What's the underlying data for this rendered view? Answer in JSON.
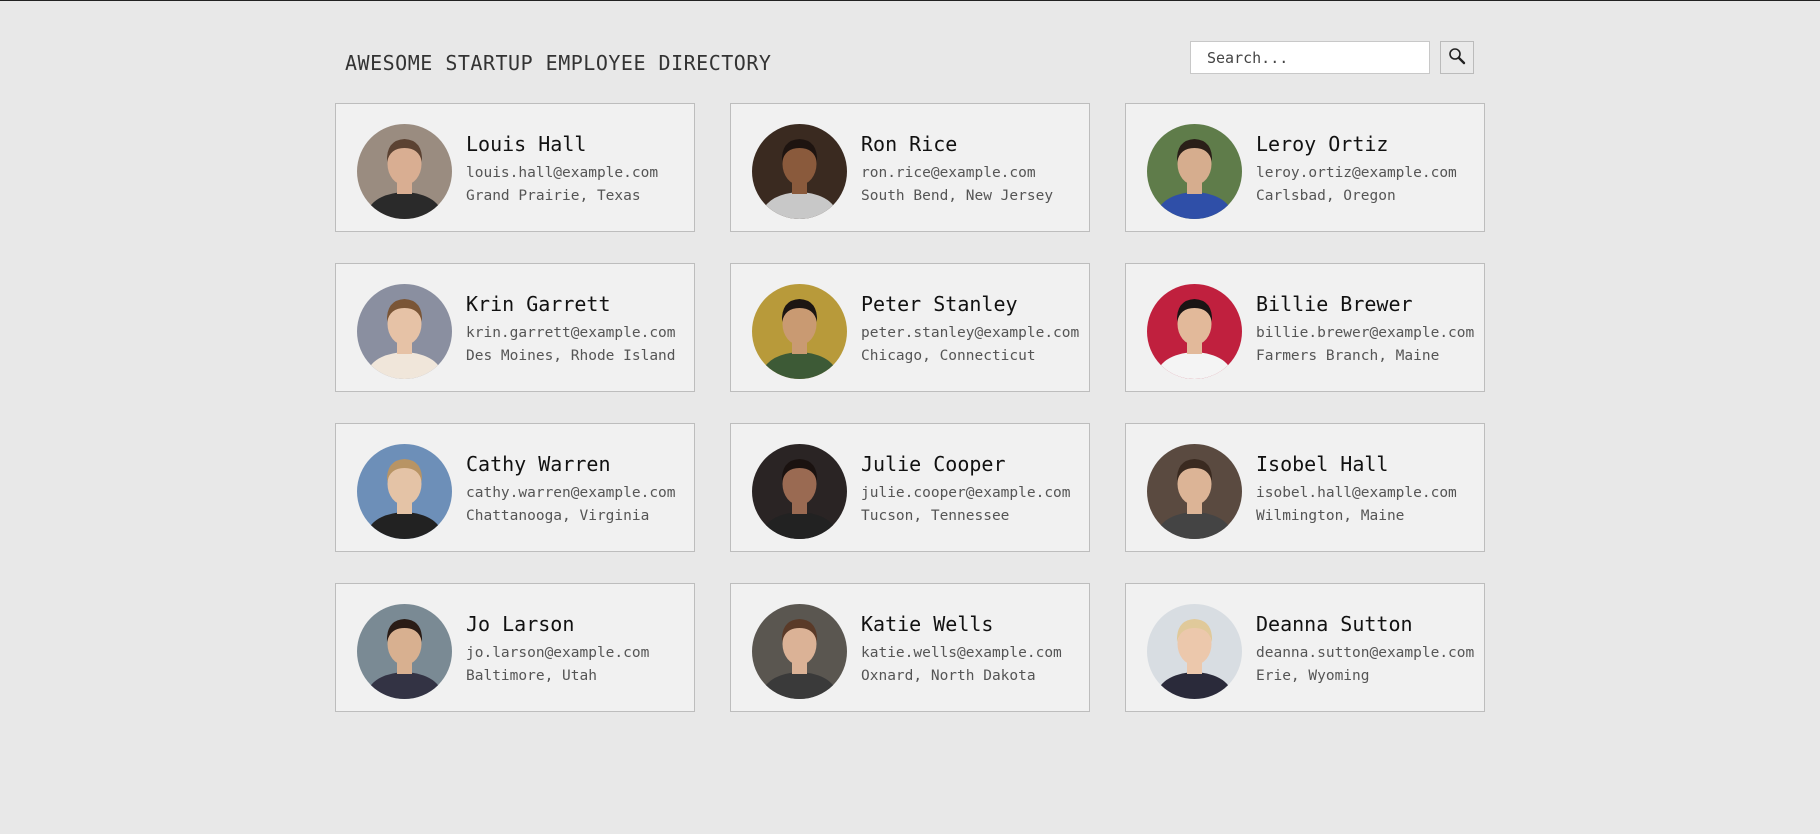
{
  "header": {
    "title": "AWESOME STARTUP EMPLOYEE DIRECTORY",
    "search_placeholder": "Search...",
    "search_icon": "search-icon"
  },
  "employees": [
    {
      "name": "Louis Hall",
      "email": "louis.hall@example.com",
      "location": "Grand Prairie, Texas",
      "bg": "#9a8c80",
      "skin": "#d9ae92",
      "hair": "#5b4232",
      "shirt": "#2a2a2a"
    },
    {
      "name": "Ron Rice",
      "email": "ron.rice@example.com",
      "location": "South Bend, New Jersey",
      "bg": "#3a2a20",
      "skin": "#8a5a3c",
      "hair": "#1e1410",
      "shirt": "#c8c8c8"
    },
    {
      "name": "Leroy Ortiz",
      "email": "leroy.ortiz@example.com",
      "location": "Carlsbad, Oregon",
      "bg": "#5f7c4a",
      "skin": "#d6ad8e",
      "hair": "#2a1f18",
      "shirt": "#2f4fa8"
    },
    {
      "name": "Krin Garrett",
      "email": "krin.garrett@example.com",
      "location": "Des Moines, Rhode Island",
      "bg": "#8a8fa0",
      "skin": "#e6c2a6",
      "hair": "#7a5536",
      "shirt": "#f0e6da"
    },
    {
      "name": "Peter Stanley",
      "email": "peter.stanley@example.com",
      "location": "Chicago, Connecticut",
      "bg": "#b89a3a",
      "skin": "#c99a72",
      "hair": "#1c1612",
      "shirt": "#3d5a36"
    },
    {
      "name": "Billie Brewer",
      "email": "billie.brewer@example.com",
      "location": "Farmers Branch, Maine",
      "bg": "#c0203e",
      "skin": "#e2b99a",
      "hair": "#1a1414",
      "shirt": "#f4f4f4"
    },
    {
      "name": "Cathy Warren",
      "email": "cathy.warren@example.com",
      "location": "Chattanooga, Virginia",
      "bg": "#6d8fb8",
      "skin": "#e4c3a6",
      "hair": "#b89464",
      "shirt": "#222"
    },
    {
      "name": "Julie Cooper",
      "email": "julie.cooper@example.com",
      "location": "Tucson, Tennessee",
      "bg": "#2a2424",
      "skin": "#9a6a52",
      "hair": "#1a1210",
      "shirt": "#222"
    },
    {
      "name": "Isobel Hall",
      "email": "isobel.hall@example.com",
      "location": "Wilmington, Maine",
      "bg": "#5a4a40",
      "skin": "#dcb496",
      "hair": "#3a2a20",
      "shirt": "#444"
    },
    {
      "name": "Jo Larson",
      "email": "jo.larson@example.com",
      "location": "Baltimore, Utah",
      "bg": "#7a8a94",
      "skin": "#d8b090",
      "hair": "#2a1c16",
      "shirt": "#334"
    },
    {
      "name": "Katie Wells",
      "email": "katie.wells@example.com",
      "location": "Oxnard, North Dakota",
      "bg": "#5a5650",
      "skin": "#dbb296",
      "hair": "#5a3a28",
      "shirt": "#3a3a3a"
    },
    {
      "name": "Deanna Sutton",
      "email": "deanna.sutton@example.com",
      "location": "Erie, Wyoming",
      "bg": "#d8dde2",
      "skin": "#ecc8ac",
      "hair": "#e0c99a",
      "shirt": "#2a2a3a"
    }
  ]
}
